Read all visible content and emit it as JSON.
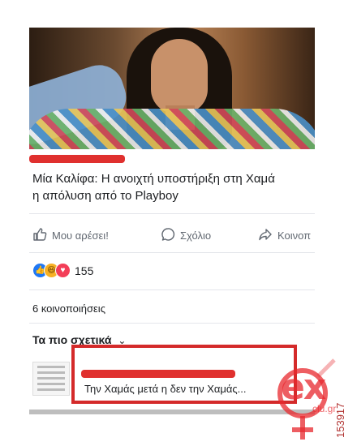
{
  "post": {
    "headline_line1": "Μία Καλίφα: Η ανοιχτή υποστήριξη στη Χαμά",
    "headline_line2": "η απόλυση από το Playboy"
  },
  "actions": {
    "like_label": "Μου αρέσει!",
    "comment_label": "Σχόλιο",
    "share_label": "Κοινοπ"
  },
  "reactions": {
    "count": "155",
    "icons": [
      "like-icon",
      "haha-icon",
      "love-icon"
    ]
  },
  "shares": "6 κοινοποιήσεις",
  "related": {
    "title": "Τα πιο σχετικά",
    "chevron": "⌄",
    "item_text": "Την Χαμάς μετά η δεν την Χαμάς..."
  },
  "watermark": {
    "brand": "ex",
    "sub": "clu.gr",
    "id": "153917"
  },
  "colors": {
    "accent_red": "#e0302e",
    "facebook_blue": "#2078f4",
    "text": "#1c1e21",
    "muted": "#606770"
  }
}
